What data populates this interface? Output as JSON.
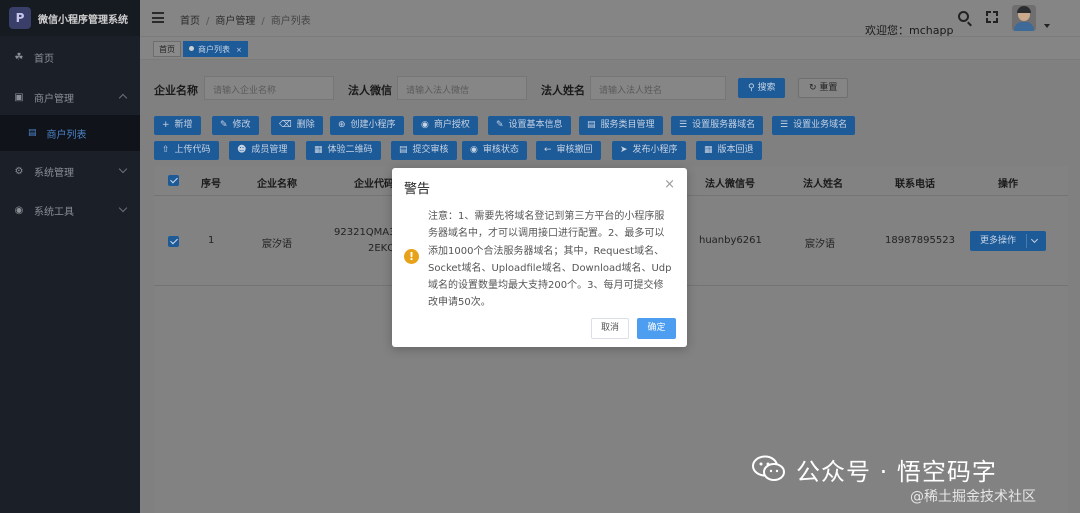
{
  "app": {
    "title": "微信小程序管理系统",
    "logo_text": "P"
  },
  "sidebar": {
    "items": [
      {
        "label": "首页",
        "icon": "dashboard-icon"
      },
      {
        "label": "商户管理",
        "icon": "monitor-icon"
      },
      {
        "label": "系统管理",
        "icon": "gear-icon"
      },
      {
        "label": "系统工具",
        "icon": "tools-icon"
      }
    ],
    "sub_item": {
      "label": "商户列表",
      "icon": "list-icon"
    }
  },
  "header": {
    "breadcrumb": [
      "首页",
      "商户管理",
      "商户列表"
    ],
    "separator": "/",
    "welcome": "欢迎您：mchapp"
  },
  "tags": [
    {
      "label": "首页"
    },
    {
      "label": "商户列表",
      "close": "×"
    }
  ],
  "search": {
    "company_label": "企业名称",
    "company_placeholder": "请输入企业名称",
    "legal_wechat_label": "法人微信",
    "legal_wechat_placeholder": "请输入法人微信",
    "legal_name_label": "法人姓名",
    "legal_name_placeholder": "请输入法人姓名",
    "search_button": "搜索",
    "reset_button": "重置"
  },
  "toolbar": {
    "row1": [
      "新增",
      "修改",
      "删除",
      "创建小程序",
      "商户授权",
      "设置基本信息",
      "服务类目管理",
      "设置服务器域名",
      "设置业务域名"
    ],
    "row2": [
      "上传代码",
      "成员管理",
      "体验二维码",
      "提交审核",
      "审核状态",
      "审核撤回",
      "发布小程序",
      "版本回退"
    ]
  },
  "table": {
    "headers": [
      "序号",
      "企业名称",
      "企业代码",
      "法人微信号",
      "法人姓名",
      "联系电话",
      "操作"
    ],
    "rows": [
      {
        "index": "1",
        "company": "宸汐语",
        "code_line1": "92321QMA34",
        "code_line2": "2EKQ4",
        "wechat": "huanby6261",
        "legal_name": "宸汐语",
        "phone": "18987895523",
        "action": "更多操作"
      }
    ]
  },
  "dialog": {
    "title": "警告",
    "close": "×",
    "icon": "!",
    "message": "注意：1、需要先将域名登记到第三方平台的小程序服务器域名中，才可以调用接口进行配置。2、最多可以添加1000个合法服务器域名；其中，Request域名、Socket域名、Uploadfile域名、Download域名、Udp域名的设置数量均最大支持200个。3、每月可提交修改申请50次。",
    "cancel": "取消",
    "confirm": "确定"
  },
  "watermark": {
    "line1": "公众号 · 悟空码字",
    "line2": "@稀土掘金技术社区"
  },
  "colors": {
    "sidebar_bg": "#1b2028",
    "primary": "#1d5a98",
    "confirm": "#4d9ef0",
    "warning": "#e8a219"
  }
}
